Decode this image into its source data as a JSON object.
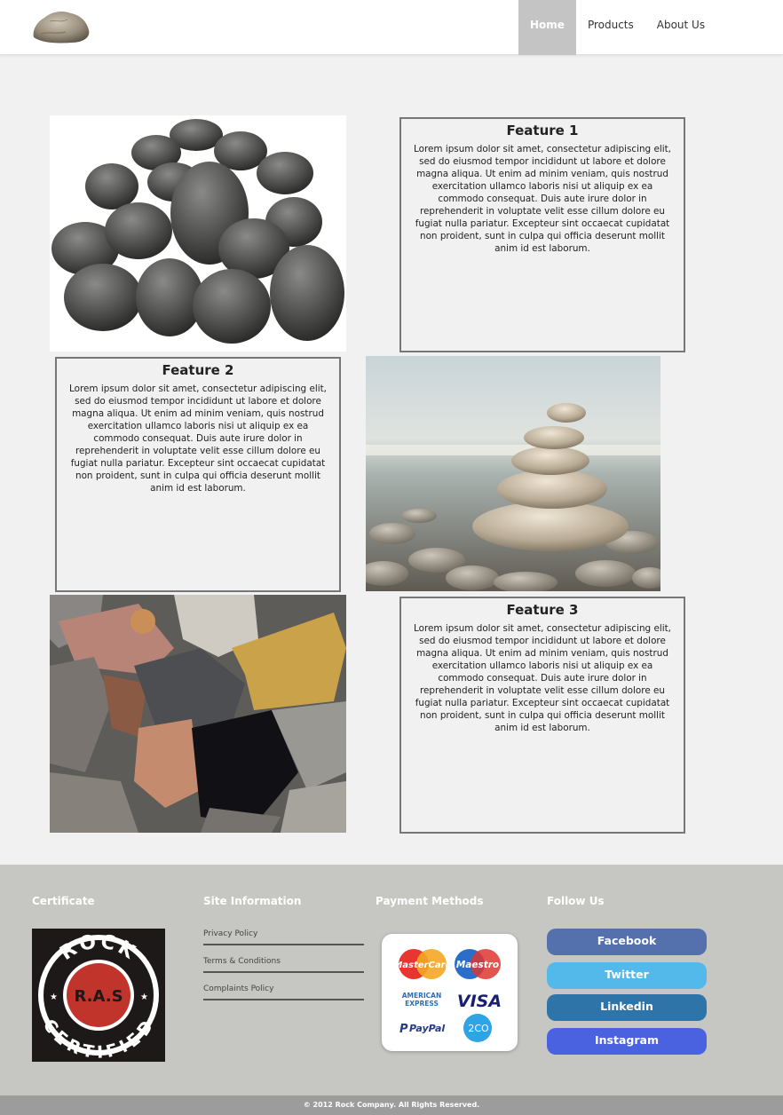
{
  "header": {
    "logo_icon": "rock-logo-icon",
    "nav": [
      {
        "label": "Home",
        "active": true
      },
      {
        "label": "Products",
        "active": false
      },
      {
        "label": "About Us",
        "active": false
      }
    ]
  },
  "features": [
    {
      "title": "Feature 1",
      "text": "Lorem ipsum dolor sit amet, consectetur adipiscing elit, sed do eiusmod tempor incididunt ut labore et dolore magna aliqua. Ut enim ad minim veniam, quis nostrud exercitation ullamco laboris nisi ut aliquip ex ea commodo consequat. Duis aute irure dolor in reprehenderit in voluptate velit esse cillum dolore eu fugiat nulla pariatur. Excepteur sint occaecat cupidatat non proident, sunt in culpa qui officia deserunt mollit anim id est laborum."
    },
    {
      "title": "Feature 2",
      "text": "Lorem ipsum dolor sit amet, consectetur adipiscing elit, sed do eiusmod tempor incididunt ut labore et dolore magna aliqua. Ut enim ad minim veniam, quis nostrud exercitation ullamco laboris nisi ut aliquip ex ea commodo consequat. Duis aute irure dolor in reprehenderit in voluptate velit esse cillum dolore eu fugiat nulla pariatur. Excepteur sint occaecat cupidatat non proident, sunt in culpa qui officia deserunt mollit anim id est laborum."
    },
    {
      "title": "Feature 3",
      "text": "Lorem ipsum dolor sit amet, consectetur adipiscing elit, sed do eiusmod tempor incididunt ut labore et dolore magna aliqua. Ut enim ad minim veniam, quis nostrud exercitation ullamco laboris nisi ut aliquip ex ea commodo consequat. Duis aute irure dolor in reprehenderit in voluptate velit esse cillum dolore eu fugiat nulla pariatur. Excepteur sint occaecat cupidatat non proident, sunt in culpa qui officia deserunt mollit anim id est laborum."
    }
  ],
  "images": [
    "dark-pebbles-image",
    "stacked-stones-image",
    "colorful-rocks-image"
  ],
  "footer": {
    "certificate": {
      "title": "Certificate",
      "badge_top": "ROCK",
      "badge_center": "R.A.S",
      "badge_bottom": "CERTIFIED"
    },
    "site_info": {
      "title": "Site Information",
      "links": [
        "Privacy Policy",
        "Terms & Conditions",
        "Complaints Policy"
      ]
    },
    "payment": {
      "title": "Payment Methods",
      "cards": {
        "mastercard": "MasterCard",
        "maestro": "Maestro",
        "amex_1": "AMERICAN",
        "amex_2": "EXPRESS",
        "visa": "VISA",
        "paypal": "PayPal",
        "twoco": "2CO"
      }
    },
    "follow": {
      "title": "Follow Us",
      "buttons": [
        {
          "label": "Facebook",
          "color": "#5470ad"
        },
        {
          "label": "Twitter",
          "color": "#52b9ea"
        },
        {
          "label": "Linkedin",
          "color": "#2f74a9"
        },
        {
          "label": "Instagram",
          "color": "#4b62e0"
        }
      ]
    },
    "copyright": "© 2012 Rock Company. All Rights Reserved."
  }
}
